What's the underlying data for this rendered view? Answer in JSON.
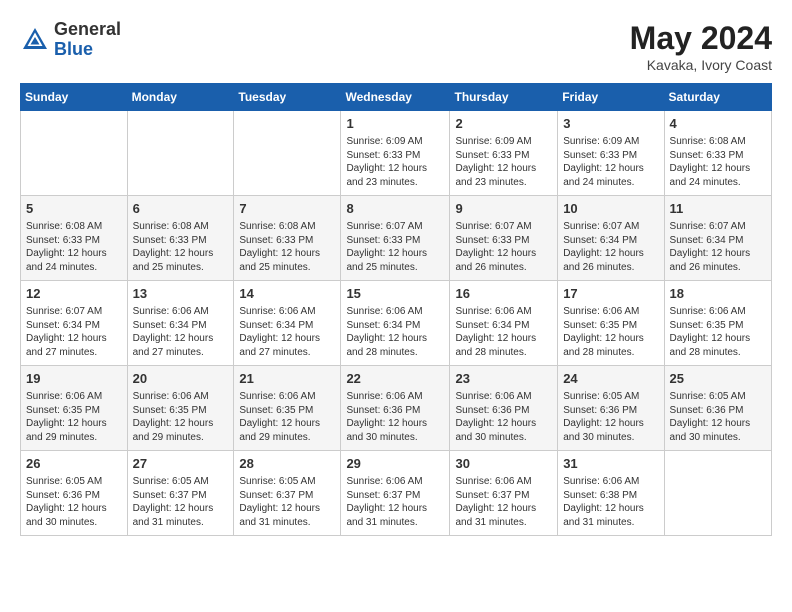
{
  "header": {
    "logo_line1": "General",
    "logo_line2": "Blue",
    "month_year": "May 2024",
    "location": "Kavaka, Ivory Coast"
  },
  "weekdays": [
    "Sunday",
    "Monday",
    "Tuesday",
    "Wednesday",
    "Thursday",
    "Friday",
    "Saturday"
  ],
  "weeks": [
    [
      {
        "day": "",
        "info": ""
      },
      {
        "day": "",
        "info": ""
      },
      {
        "day": "",
        "info": ""
      },
      {
        "day": "1",
        "info": "Sunrise: 6:09 AM\nSunset: 6:33 PM\nDaylight: 12 hours\nand 23 minutes."
      },
      {
        "day": "2",
        "info": "Sunrise: 6:09 AM\nSunset: 6:33 PM\nDaylight: 12 hours\nand 23 minutes."
      },
      {
        "day": "3",
        "info": "Sunrise: 6:09 AM\nSunset: 6:33 PM\nDaylight: 12 hours\nand 24 minutes."
      },
      {
        "day": "4",
        "info": "Sunrise: 6:08 AM\nSunset: 6:33 PM\nDaylight: 12 hours\nand 24 minutes."
      }
    ],
    [
      {
        "day": "5",
        "info": "Sunrise: 6:08 AM\nSunset: 6:33 PM\nDaylight: 12 hours\nand 24 minutes."
      },
      {
        "day": "6",
        "info": "Sunrise: 6:08 AM\nSunset: 6:33 PM\nDaylight: 12 hours\nand 25 minutes."
      },
      {
        "day": "7",
        "info": "Sunrise: 6:08 AM\nSunset: 6:33 PM\nDaylight: 12 hours\nand 25 minutes."
      },
      {
        "day": "8",
        "info": "Sunrise: 6:07 AM\nSunset: 6:33 PM\nDaylight: 12 hours\nand 25 minutes."
      },
      {
        "day": "9",
        "info": "Sunrise: 6:07 AM\nSunset: 6:33 PM\nDaylight: 12 hours\nand 26 minutes."
      },
      {
        "day": "10",
        "info": "Sunrise: 6:07 AM\nSunset: 6:34 PM\nDaylight: 12 hours\nand 26 minutes."
      },
      {
        "day": "11",
        "info": "Sunrise: 6:07 AM\nSunset: 6:34 PM\nDaylight: 12 hours\nand 26 minutes."
      }
    ],
    [
      {
        "day": "12",
        "info": "Sunrise: 6:07 AM\nSunset: 6:34 PM\nDaylight: 12 hours\nand 27 minutes."
      },
      {
        "day": "13",
        "info": "Sunrise: 6:06 AM\nSunset: 6:34 PM\nDaylight: 12 hours\nand 27 minutes."
      },
      {
        "day": "14",
        "info": "Sunrise: 6:06 AM\nSunset: 6:34 PM\nDaylight: 12 hours\nand 27 minutes."
      },
      {
        "day": "15",
        "info": "Sunrise: 6:06 AM\nSunset: 6:34 PM\nDaylight: 12 hours\nand 28 minutes."
      },
      {
        "day": "16",
        "info": "Sunrise: 6:06 AM\nSunset: 6:34 PM\nDaylight: 12 hours\nand 28 minutes."
      },
      {
        "day": "17",
        "info": "Sunrise: 6:06 AM\nSunset: 6:35 PM\nDaylight: 12 hours\nand 28 minutes."
      },
      {
        "day": "18",
        "info": "Sunrise: 6:06 AM\nSunset: 6:35 PM\nDaylight: 12 hours\nand 28 minutes."
      }
    ],
    [
      {
        "day": "19",
        "info": "Sunrise: 6:06 AM\nSunset: 6:35 PM\nDaylight: 12 hours\nand 29 minutes."
      },
      {
        "day": "20",
        "info": "Sunrise: 6:06 AM\nSunset: 6:35 PM\nDaylight: 12 hours\nand 29 minutes."
      },
      {
        "day": "21",
        "info": "Sunrise: 6:06 AM\nSunset: 6:35 PM\nDaylight: 12 hours\nand 29 minutes."
      },
      {
        "day": "22",
        "info": "Sunrise: 6:06 AM\nSunset: 6:36 PM\nDaylight: 12 hours\nand 30 minutes."
      },
      {
        "day": "23",
        "info": "Sunrise: 6:06 AM\nSunset: 6:36 PM\nDaylight: 12 hours\nand 30 minutes."
      },
      {
        "day": "24",
        "info": "Sunrise: 6:05 AM\nSunset: 6:36 PM\nDaylight: 12 hours\nand 30 minutes."
      },
      {
        "day": "25",
        "info": "Sunrise: 6:05 AM\nSunset: 6:36 PM\nDaylight: 12 hours\nand 30 minutes."
      }
    ],
    [
      {
        "day": "26",
        "info": "Sunrise: 6:05 AM\nSunset: 6:36 PM\nDaylight: 12 hours\nand 30 minutes."
      },
      {
        "day": "27",
        "info": "Sunrise: 6:05 AM\nSunset: 6:37 PM\nDaylight: 12 hours\nand 31 minutes."
      },
      {
        "day": "28",
        "info": "Sunrise: 6:05 AM\nSunset: 6:37 PM\nDaylight: 12 hours\nand 31 minutes."
      },
      {
        "day": "29",
        "info": "Sunrise: 6:06 AM\nSunset: 6:37 PM\nDaylight: 12 hours\nand 31 minutes."
      },
      {
        "day": "30",
        "info": "Sunrise: 6:06 AM\nSunset: 6:37 PM\nDaylight: 12 hours\nand 31 minutes."
      },
      {
        "day": "31",
        "info": "Sunrise: 6:06 AM\nSunset: 6:38 PM\nDaylight: 12 hours\nand 31 minutes."
      },
      {
        "day": "",
        "info": ""
      }
    ]
  ]
}
